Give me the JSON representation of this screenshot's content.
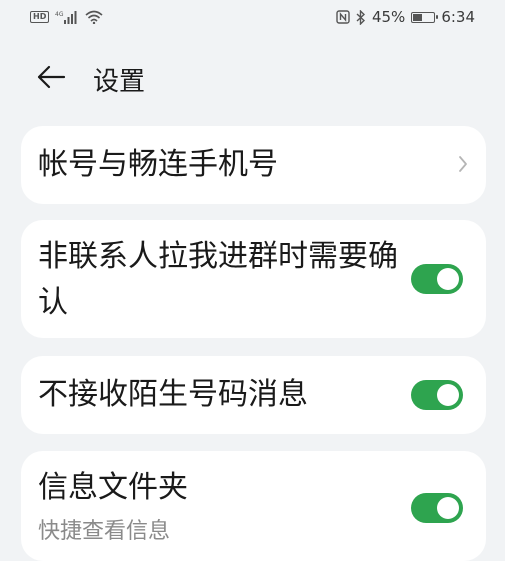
{
  "status_bar": {
    "left_badges": [
      "HD",
      "4G"
    ],
    "battery_percent": "45%",
    "battery_level": 0.45,
    "time": "6:34",
    "icons": [
      "hd-icon",
      "signal-icon",
      "wifi-icon",
      "nfc-icon",
      "bluetooth-icon",
      "battery-icon"
    ]
  },
  "header": {
    "back_icon": "arrow-left-icon",
    "title": "设置"
  },
  "settings": [
    {
      "label": "帐号与畅连手机号",
      "type": "link",
      "icon": "chevron-right-icon"
    },
    {
      "label": "非联系人拉我进群时需要确认",
      "type": "toggle",
      "enabled": true
    },
    {
      "label": "不接收陌生号码消息",
      "type": "toggle",
      "enabled": true
    },
    {
      "label": "信息文件夹",
      "sublabel": "快捷查看信息",
      "type": "toggle",
      "enabled": true
    }
  ],
  "colors": {
    "background": "#f1f3f5",
    "card": "#ffffff",
    "toggle_on": "#2ea44f",
    "text_primary": "#1a1a1a",
    "text_secondary": "#8a8a8a"
  }
}
